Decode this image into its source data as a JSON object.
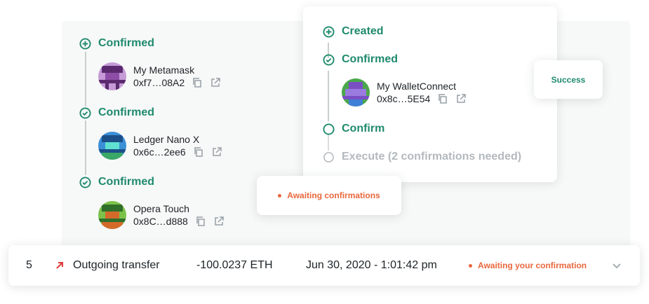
{
  "owners_panel": {
    "entries": [
      {
        "status": "Confirmed",
        "name": "My Metamask",
        "address": "0xf7…08A2"
      },
      {
        "status": "Confirmed",
        "name": "Ledger Nano X",
        "address": "0x6c…2ee6"
      },
      {
        "status": "Confirmed",
        "name": "Opera Touch",
        "address": "0x8C…d888"
      }
    ]
  },
  "timeline_card": {
    "created": "Created",
    "confirmed": "Confirmed",
    "owner": {
      "name": "My WalletConnect",
      "address": "0x8c…5E54"
    },
    "confirm": "Confirm",
    "execute": "Execute (2 confirmations needed)"
  },
  "success_badge": {
    "label": "Success"
  },
  "awaiting_badge": {
    "label": "Awaiting confirmations"
  },
  "transaction": {
    "nonce": "5",
    "type": "Outgoing transfer",
    "amount": "-100.0237 ETH",
    "date": "Jun 30, 2020 - 1:01:42 pm",
    "status": "Awaiting your confirmation"
  },
  "colors": {
    "green": "#1f8a6d",
    "orange": "#e8673c",
    "grey": "#b3b9bd",
    "red_arrow": "#e23a3a"
  }
}
